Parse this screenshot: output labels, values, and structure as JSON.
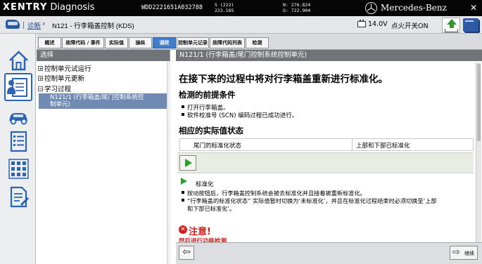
{
  "topbar": {
    "brand_prefix": "XENTRY",
    "brand_suffix": "Diagnosis",
    "vin": "WDD2221651A032788",
    "s_line1": "S (222)",
    "s_line2": "222.165",
    "n_line1": "N: 276.824",
    "n_line2": "G: 722.904",
    "mercedes": "Mercedes-Benz",
    "close_symbol": "✕"
  },
  "nav": {
    "link": "诊断",
    "arrow": "›",
    "title": "N121 - 行李箱盖控制 (KDS)",
    "voltage": "14.0V",
    "ignition": "点火开关ON"
  },
  "tabs": [
    {
      "label": "概述",
      "active": false
    },
    {
      "label": "故障代码 / 事件",
      "active": false
    },
    {
      "label": "实际值",
      "active": false
    },
    {
      "label": "操纵",
      "active": false
    },
    {
      "label": "调校",
      "active": true
    },
    {
      "label": "控制单元记录",
      "active": false
    },
    {
      "label": "故障代码列表",
      "active": false
    },
    {
      "label": "检测",
      "active": false
    }
  ],
  "tree": {
    "header": "选择",
    "items": [
      {
        "toggle": "+",
        "label": "控制单元试运行"
      },
      {
        "toggle": "+",
        "label": "控制单元更新"
      },
      {
        "toggle": "−",
        "label": "学习过程"
      }
    ],
    "selected_line1": "N121/1 (行李箱盖/尾门控制系统控",
    "selected_line2": "制单元)"
  },
  "main": {
    "header": "N121/1 (行李箱盖/尾门控制系统控制单元)",
    "heading": "在接下来的过程中将对行李箱盖重新进行标准化。",
    "prereq_title": "检测的前提条件",
    "prereq_items": [
      "打开行李箱盖。",
      "软件校准号 (SCN) 编码过程已成功进行。"
    ],
    "status_title": "相应的实际值状态",
    "status_col1": "尾门的标准化状态",
    "status_col2": "上部和下部已标准化",
    "std_label": "标准化",
    "std_items": [
      "按动按钮后，行李箱盖控制系统会被去标准化并且接着被重新标准化。",
      "“行李箱盖的标准化状态” 实际值暂时切换为‘未标准化’，并且在标准化过程结束时必须切换至‘上部",
      "和下部已标准化’。"
    ],
    "warning_icon": "✕",
    "warning_title": "注意!",
    "warning_sub": "然后进行功能检测"
  },
  "bottom": {
    "back_symbol": "⇦",
    "continue_symbol": "⇨",
    "continue_label": "继续"
  },
  "colors": {
    "topbar": "#050505",
    "tab_active": "#3f7fce",
    "panel_header": "#707378",
    "tree_selected": "#6f8bb3",
    "warning": "#d21b1b",
    "play_green": "#2ea22e"
  }
}
